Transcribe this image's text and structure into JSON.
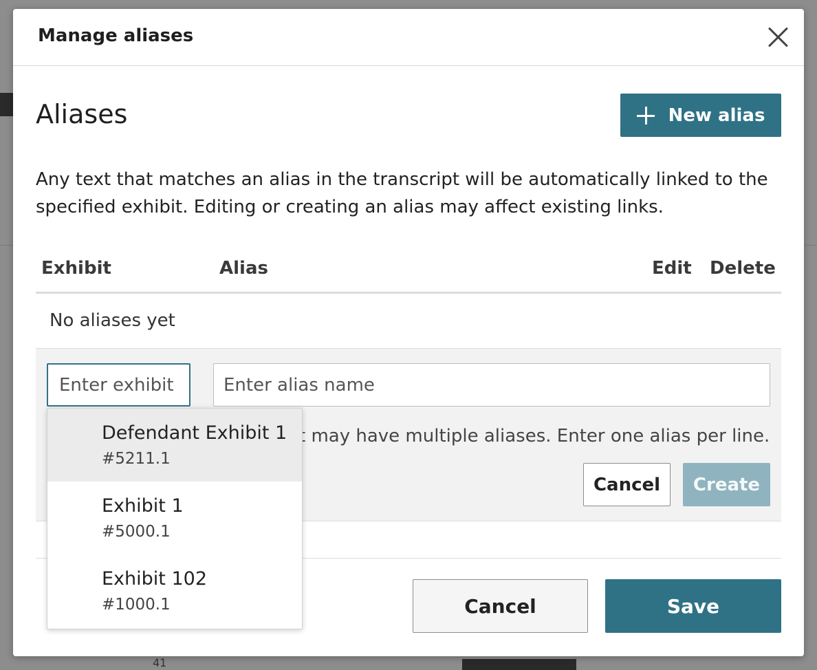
{
  "modal": {
    "title": "Manage aliases",
    "heading": "Aliases",
    "new_alias_label": "New alias",
    "description": "Any text that matches an alias in the transcript will be automatically linked to the specified exhibit. Editing or creating an alias may affect existing links."
  },
  "table": {
    "columns": {
      "exhibit": "Exhibit",
      "alias": "Alias",
      "edit": "Edit",
      "delete": "Delete"
    },
    "empty_message": "No aliases yet"
  },
  "create_form": {
    "exhibit_placeholder": "Enter exhibit",
    "alias_placeholder": "Enter alias name",
    "hint": "t may have multiple aliases. Enter one alias per line.",
    "cancel_label": "Cancel",
    "create_label": "Create"
  },
  "dropdown": {
    "options": [
      {
        "name": "Defendant Exhibit 1",
        "id": "#5211.1"
      },
      {
        "name": "Exhibit 1",
        "id": "#5000.1"
      },
      {
        "name": "Exhibit 102",
        "id": "#1000.1"
      }
    ]
  },
  "footer": {
    "cancel_label": "Cancel",
    "save_label": "Save"
  },
  "backdrop": {
    "bottom_text": "41"
  },
  "colors": {
    "accent": "#2f7286",
    "accent_disabled": "#8fb3bf",
    "overlay": "#8d8d8d"
  }
}
